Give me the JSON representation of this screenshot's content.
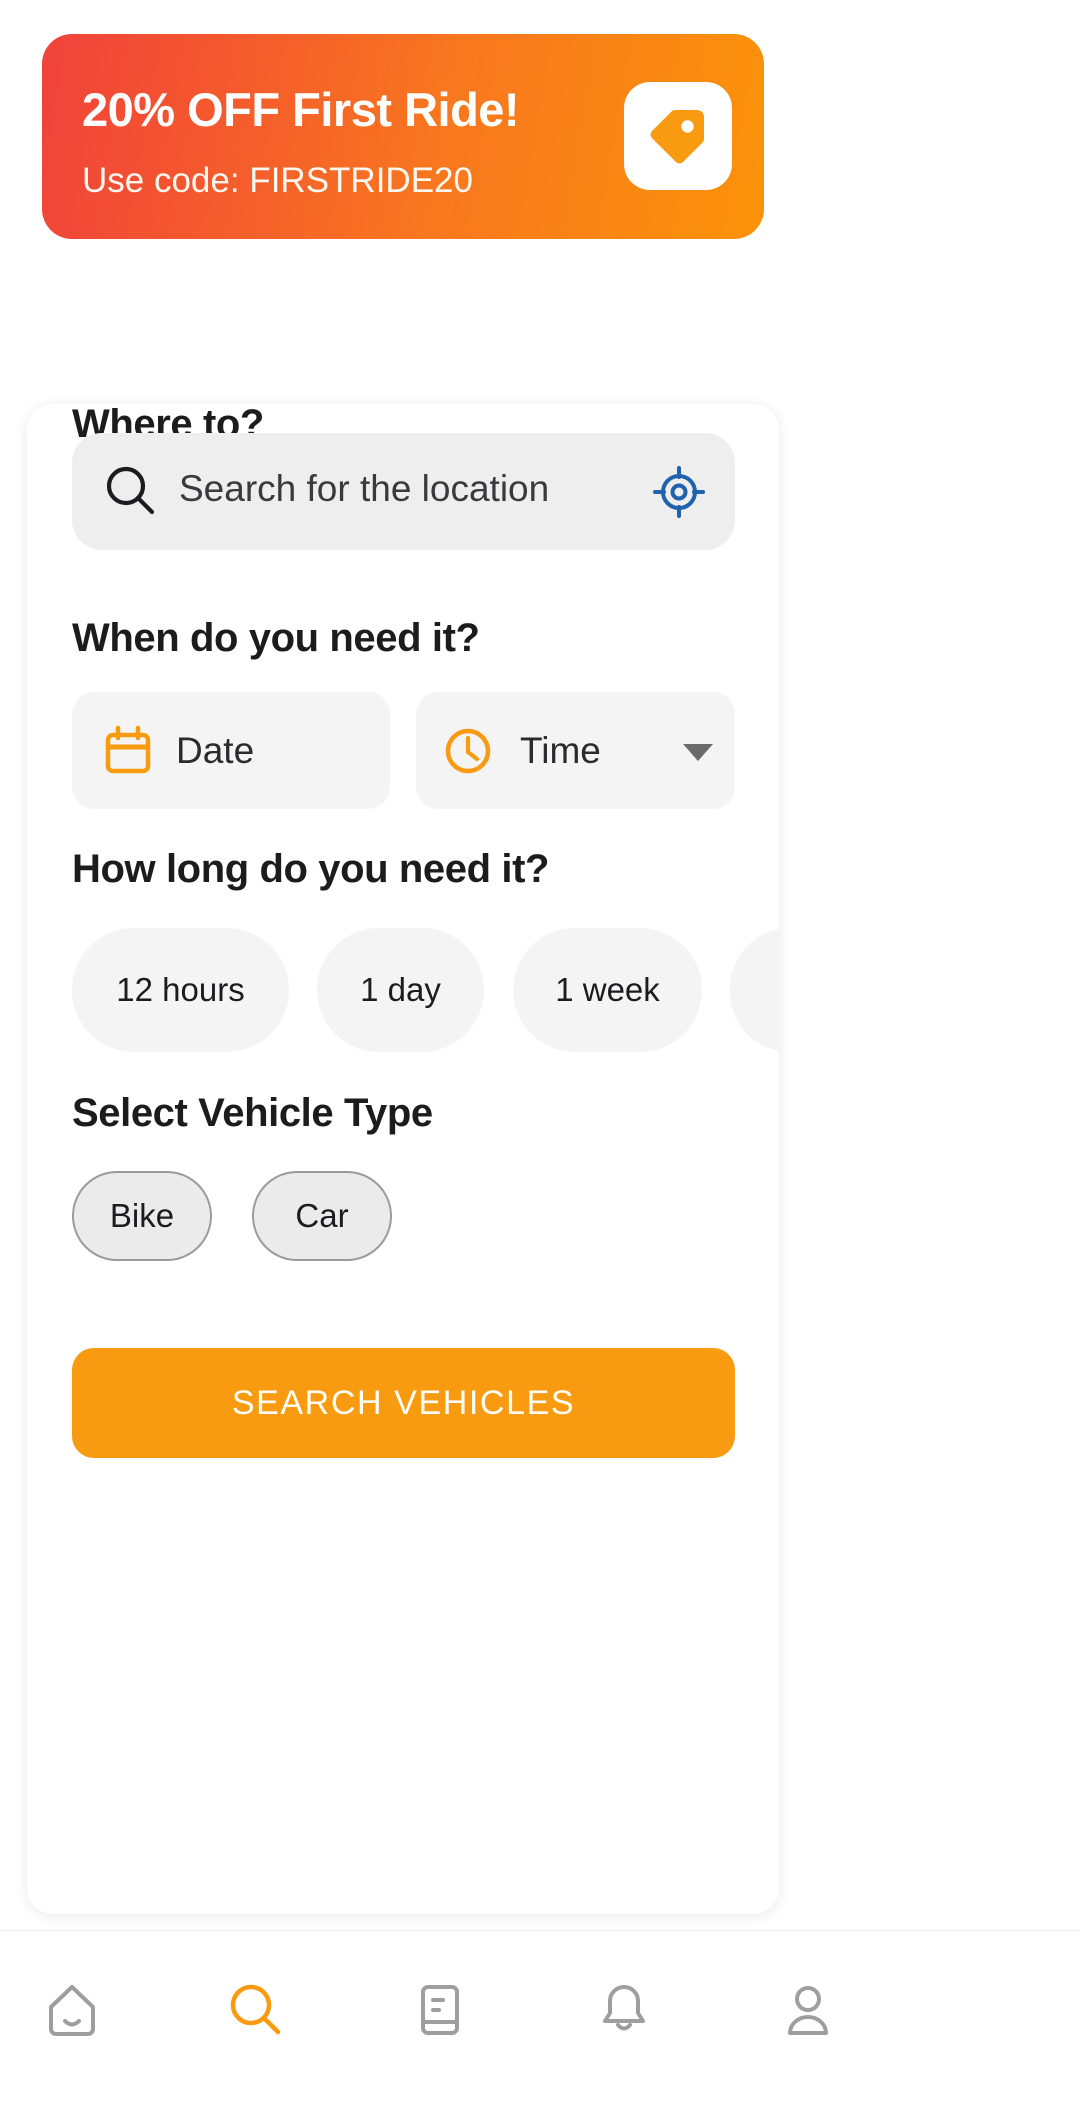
{
  "promo": {
    "title": "20% OFF First Ride!",
    "subtitle": "Use code: FIRSTRIDE20",
    "badge_icon": "price-tag-icon",
    "gradient_from": "#f0423c",
    "gradient_to": "#fb9309"
  },
  "form": {
    "where_heading": "Where to?",
    "search": {
      "placeholder": "Search for the location",
      "value": "",
      "leading_icon": "search-icon",
      "trailing_icon": "gps-locate-icon",
      "gps_color": "#1f62ad"
    },
    "when_heading": "When do you need it?",
    "date": {
      "label": "Date",
      "icon": "calendar-icon",
      "icon_color": "#f89b10"
    },
    "time": {
      "label": "Time",
      "icon": "clock-icon",
      "icon_color": "#f89b10",
      "dropdown_icon": "chevron-down-icon"
    },
    "duration_heading": "How long do you need it?",
    "durations": [
      {
        "label": "12 hours",
        "selected": false
      },
      {
        "label": "1 day",
        "selected": false
      },
      {
        "label": "1 week",
        "selected": false
      }
    ],
    "vehicle_heading": "Select Vehicle Type",
    "vehicles": [
      {
        "label": "Bike",
        "selected": false
      },
      {
        "label": "Car",
        "selected": false
      }
    ],
    "submit_label": "SEARCH VEHICLES",
    "submit_color": "#f89b10"
  },
  "bottom_nav": {
    "active_color": "#f89b10",
    "inactive_color": "#9e9e9e",
    "items": [
      {
        "name": "home",
        "icon": "home-icon",
        "active": false
      },
      {
        "name": "search",
        "icon": "search-icon",
        "active": true
      },
      {
        "name": "bookings",
        "icon": "book-icon",
        "active": false
      },
      {
        "name": "notifications",
        "icon": "bell-icon",
        "active": false
      },
      {
        "name": "profile",
        "icon": "person-icon",
        "active": false
      }
    ]
  }
}
